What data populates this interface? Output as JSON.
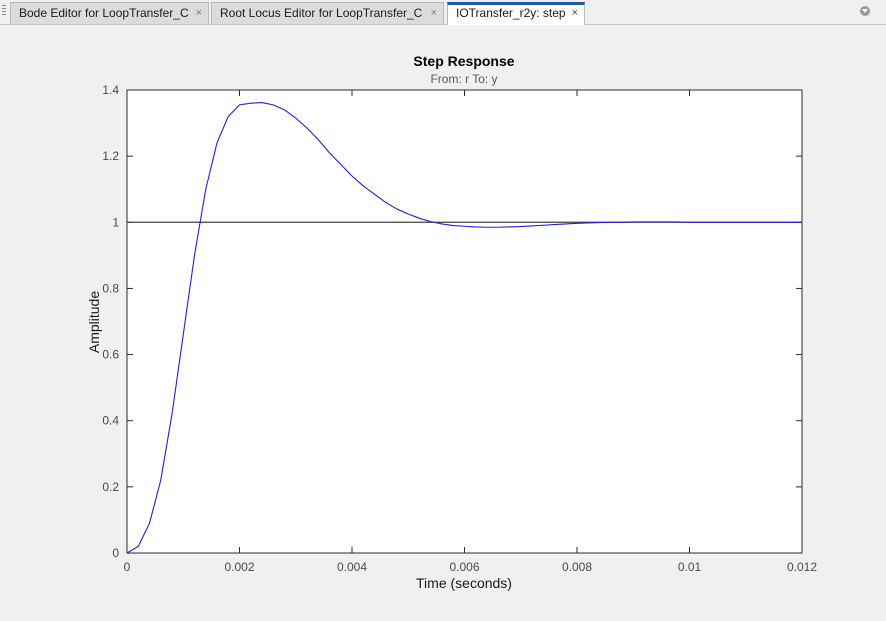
{
  "tabs": [
    {
      "label": "Bode Editor for LoopTransfer_C",
      "close": "×",
      "active": false
    },
    {
      "label": "Root Locus Editor for LoopTransfer_C",
      "close": "×",
      "active": false
    },
    {
      "label": "IOTransfer_r2y: step",
      "close": "×",
      "active": true
    }
  ],
  "chart_data": {
    "type": "line",
    "title": "Step Response",
    "subtitle": "From: r  To: y",
    "xlabel": "Time (seconds)",
    "ylabel": "Amplitude",
    "xlim": [
      0,
      0.012
    ],
    "ylim": [
      0,
      1.4
    ],
    "xticks": [
      "0",
      "0.002",
      "0.004",
      "0.006",
      "0.008",
      "0.01",
      "0.012"
    ],
    "yticks": [
      "0",
      "0.2",
      "0.4",
      "0.6",
      "0.8",
      "1",
      "1.2",
      "1.4"
    ],
    "grid": false,
    "reference_line": {
      "y": 1,
      "color": "#404040"
    },
    "series": [
      {
        "color": "#1f1fdd",
        "x": [
          0,
          0.0002,
          0.0004,
          0.0006,
          0.0008,
          0.001,
          0.0012,
          0.0014,
          0.0016,
          0.0018,
          0.002,
          0.0022,
          0.0024,
          0.0026,
          0.0028,
          0.003,
          0.0032,
          0.0034,
          0.0036,
          0.0038,
          0.004,
          0.0042,
          0.0044,
          0.0046,
          0.0048,
          0.005,
          0.0052,
          0.0054,
          0.0056,
          0.0058,
          0.006,
          0.0062,
          0.0064,
          0.0066,
          0.0068,
          0.007,
          0.0072,
          0.0074,
          0.0076,
          0.0078,
          0.008,
          0.0082,
          0.0084,
          0.0086,
          0.0088,
          0.009,
          0.0092,
          0.0094,
          0.0096,
          0.0098,
          0.01,
          0.0102,
          0.0104,
          0.0106,
          0.0108,
          0.011,
          0.0112,
          0.0114,
          0.0116,
          0.0118,
          0.012
        ],
        "y": [
          0,
          0.02,
          0.09,
          0.22,
          0.42,
          0.66,
          0.9,
          1.1,
          1.24,
          1.32,
          1.355,
          1.36,
          1.362,
          1.355,
          1.34,
          1.315,
          1.285,
          1.25,
          1.21,
          1.175,
          1.14,
          1.11,
          1.085,
          1.06,
          1.04,
          1.025,
          1.012,
          1.002,
          0.995,
          0.99,
          0.988,
          0.986,
          0.985,
          0.985,
          0.986,
          0.987,
          0.989,
          0.991,
          0.993,
          0.995,
          0.997,
          0.998,
          0.999,
          1.0,
          1.0,
          1.001,
          1.001,
          1.001,
          1.001,
          1.001,
          1.0,
          1.0,
          1.0,
          1.0,
          1.0,
          1.0,
          1.0,
          1.0,
          1.0,
          1.0,
          1.0
        ]
      }
    ]
  }
}
